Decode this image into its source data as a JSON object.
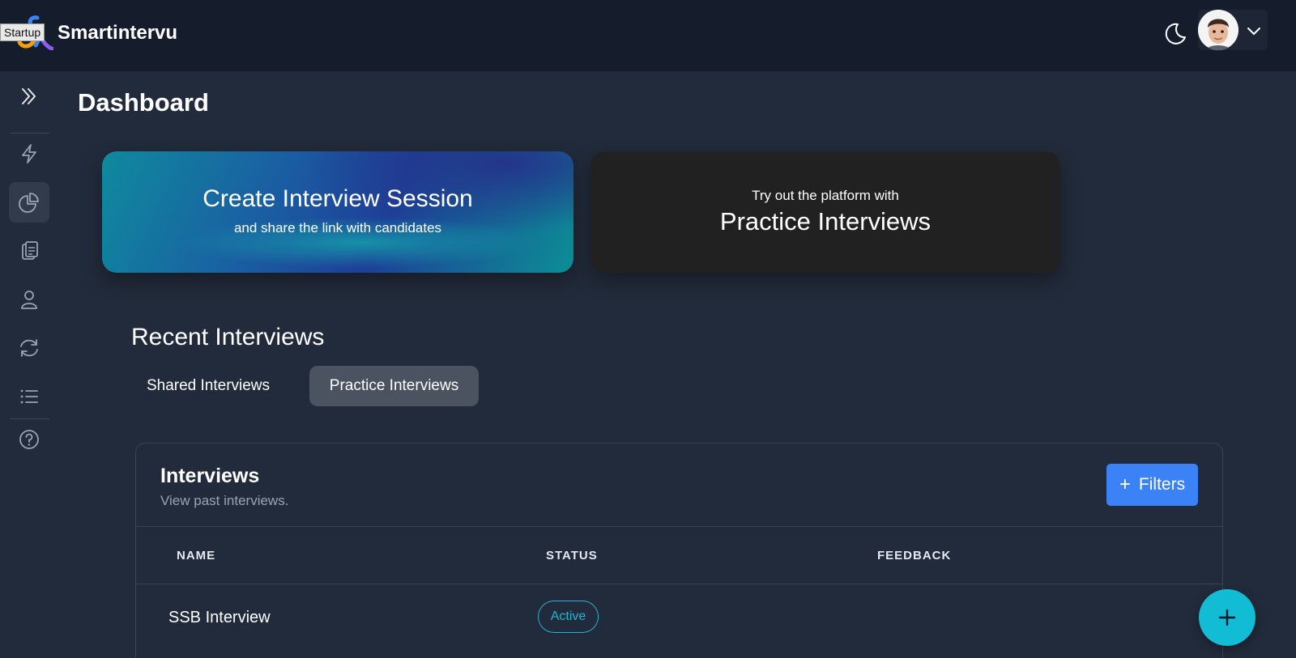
{
  "header": {
    "app_title": "Smartintervu",
    "tooltip": "Startup"
  },
  "sidebar": {
    "items": [
      {
        "icon": "double-chevron-right-icon"
      },
      {
        "icon": "lightning-icon"
      },
      {
        "icon": "pie-chart-icon",
        "active": true
      },
      {
        "icon": "clipboard-icon"
      },
      {
        "icon": "user-icon"
      },
      {
        "icon": "refresh-icon"
      },
      {
        "icon": "list-icon"
      },
      {
        "icon": "help-circle-icon"
      }
    ]
  },
  "main": {
    "page_title": "Dashboard",
    "create_card": {
      "title": "Create Interview Session",
      "subtitle": "and share the link with candidates"
    },
    "practice_card": {
      "pretext": "Try out the platform with",
      "title": "Practice Interviews"
    },
    "recent": {
      "title": "Recent Interviews",
      "tabs": [
        {
          "label": "Shared Interviews",
          "active": false
        },
        {
          "label": "Practice Interviews",
          "active": true
        }
      ]
    },
    "interviews_table": {
      "title": "Interviews",
      "subtitle": "View past interviews.",
      "filters_label": "Filters",
      "columns": [
        "NAME",
        "STATUS",
        "FEEDBACK"
      ],
      "rows": [
        {
          "name": "SSB Interview",
          "status": "Active",
          "feedback": ""
        }
      ]
    }
  },
  "colors": {
    "accent": "#3b82f6",
    "status_active": "#22b5cf",
    "fab": "#12bcd4",
    "header_bg": "#151d2d",
    "page_bg": "#222b3b"
  }
}
